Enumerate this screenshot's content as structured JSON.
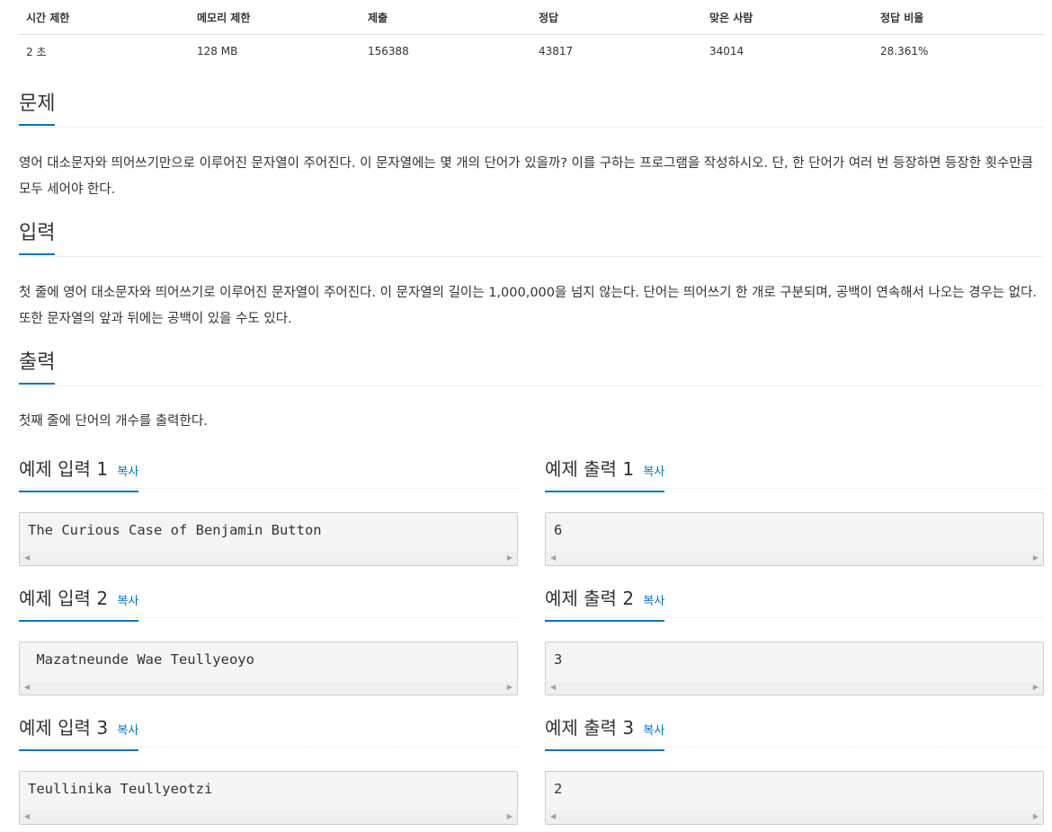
{
  "stats": {
    "headers": [
      "시간 제한",
      "메모리 제한",
      "제출",
      "정답",
      "맞은 사람",
      "정답 비율"
    ],
    "values": [
      "2 초",
      "128 MB",
      "156388",
      "43817",
      "34014",
      "28.361%"
    ]
  },
  "problem": {
    "title": "문제",
    "text": "영어 대소문자와 띄어쓰기만으로 이루어진 문자열이 주어진다. 이 문자열에는 몇 개의 단어가 있을까? 이를 구하는 프로그램을 작성하시오. 단, 한 단어가 여러 번 등장하면 등장한 횟수만큼 모두 세어야 한다."
  },
  "input": {
    "title": "입력",
    "text": "첫 줄에 영어 대소문자와 띄어쓰기로 이루어진 문자열이 주어진다. 이 문자열의 길이는 1,000,000을 넘지 않는다. 단어는 띄어쓰기 한 개로 구분되며, 공백이 연속해서 나오는 경우는 없다. 또한 문자열의 앞과 뒤에는 공백이 있을 수도 있다."
  },
  "output": {
    "title": "출력",
    "text": "첫째 줄에 단어의 개수를 출력한다."
  },
  "copy_label": "복사",
  "examples": [
    {
      "in_title": "예제 입력 1",
      "in_value": "The Curious Case of Benjamin Button",
      "out_title": "예제 출력 1",
      "out_value": "6"
    },
    {
      "in_title": "예제 입력 2",
      "in_value": " Mazatneunde Wae Teullyeoyo",
      "out_title": "예제 출력 2",
      "out_value": "3"
    },
    {
      "in_title": "예제 입력 3",
      "in_value": "Teullinika Teullyeotzi",
      "out_title": "예제 출력 3",
      "out_value": "2"
    }
  ]
}
